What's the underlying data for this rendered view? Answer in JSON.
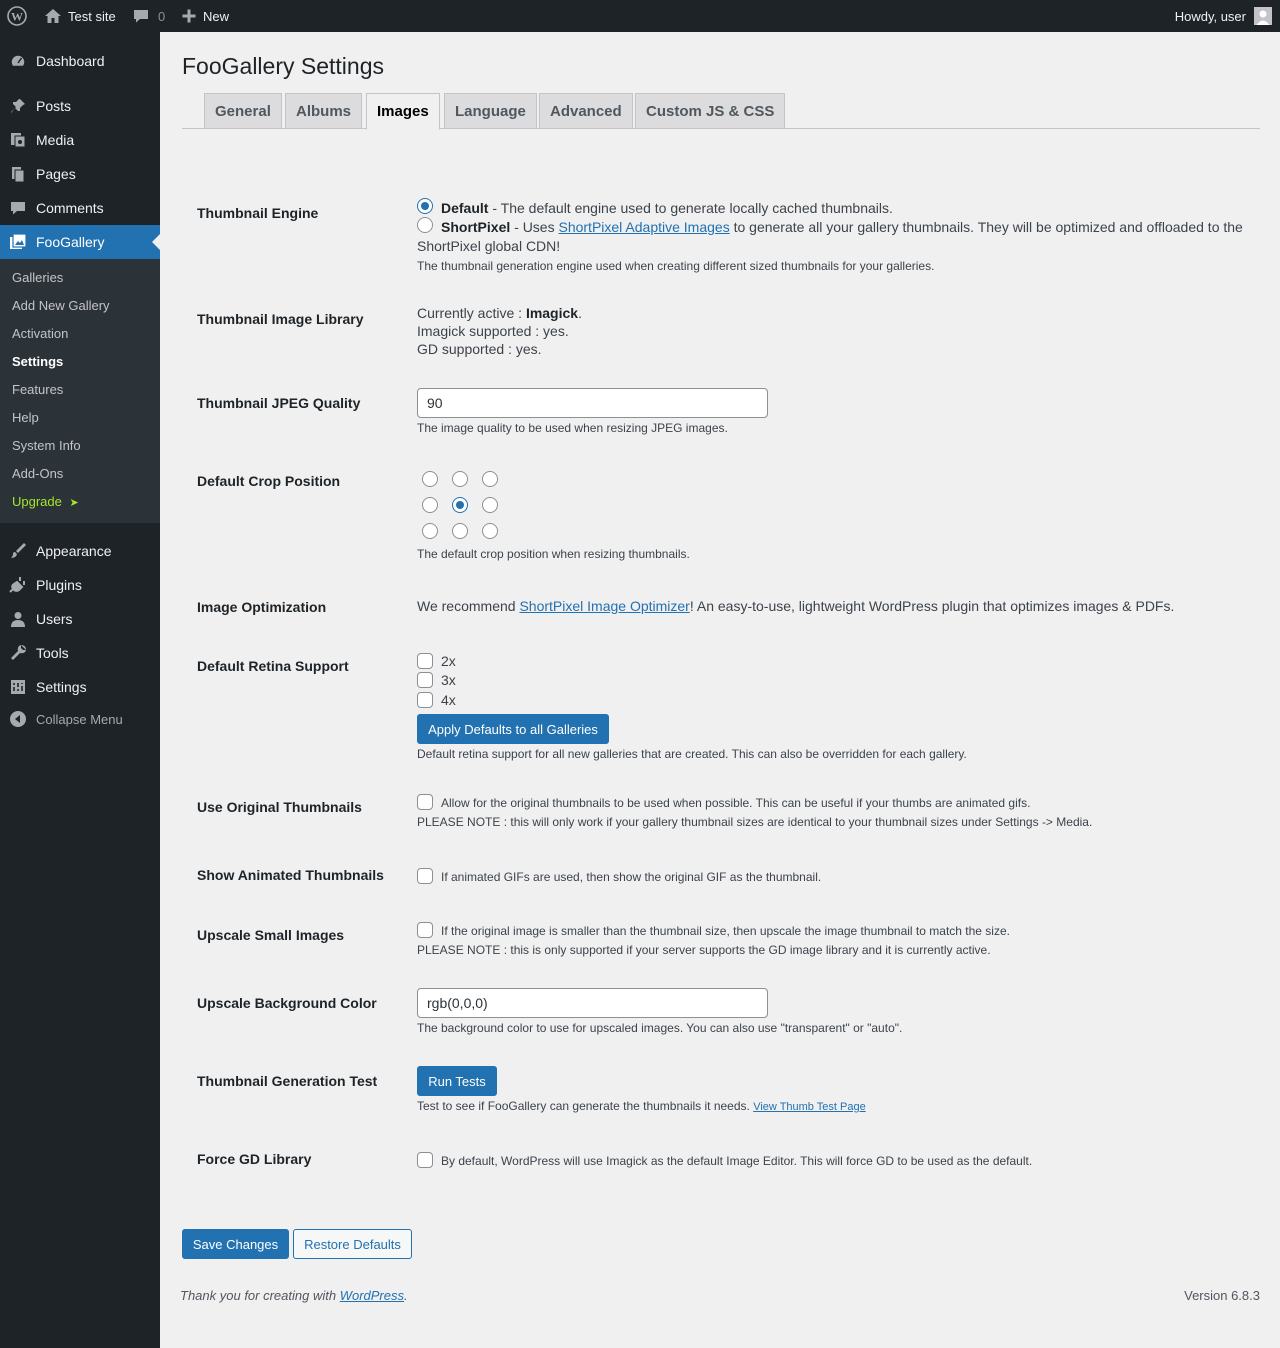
{
  "adminbar": {
    "site_name": "Test site",
    "comments_count": "0",
    "new_label": "New",
    "howdy": "Howdy, user"
  },
  "sidebar": {
    "items": [
      {
        "label": "Dashboard",
        "icon": "dashboard-icon"
      },
      {
        "label": "Posts",
        "icon": "pin-icon"
      },
      {
        "label": "Media",
        "icon": "media-icon"
      },
      {
        "label": "Pages",
        "icon": "pages-icon"
      },
      {
        "label": "Comments",
        "icon": "comment-icon"
      },
      {
        "label": "FooGallery",
        "icon": "gallery-icon",
        "active": true
      },
      {
        "label": "Appearance",
        "icon": "brush-icon"
      },
      {
        "label": "Plugins",
        "icon": "plug-icon"
      },
      {
        "label": "Users",
        "icon": "user-icon"
      },
      {
        "label": "Tools",
        "icon": "wrench-icon"
      },
      {
        "label": "Settings",
        "icon": "settings-icon"
      }
    ],
    "submenu": [
      "Galleries",
      "Add New Gallery",
      "Activation",
      "Settings",
      "Features",
      "Help",
      "System Info",
      "Add-Ons",
      "Upgrade"
    ],
    "upgrade_arrow": "➤",
    "collapse_label": "Collapse Menu"
  },
  "page": {
    "title": "FooGallery Settings",
    "tabs": [
      "General",
      "Albums",
      "Images",
      "Language",
      "Advanced",
      "Custom JS & CSS"
    ],
    "active_tab": "Images"
  },
  "settings": {
    "thumb_engine": {
      "label": "Thumbnail Engine",
      "opt1_name": "Default",
      "opt1_text": " - The default engine used to generate locally cached thumbnails.",
      "opt2_name": "ShortPixel",
      "opt2_pre": " - Uses ",
      "opt2_link": "ShortPixel Adaptive Images",
      "opt2_post": " to generate all your gallery thumbnails. They will be optimized and offloaded to the",
      "opt2_line2": "ShortPixel global CDN!",
      "desc": "The thumbnail generation engine used when creating different sized thumbnails for your galleries."
    },
    "image_library": {
      "label": "Thumbnail Image Library",
      "active_pre": "Currently active : ",
      "active_value": "Imagick",
      "active_post": ".",
      "imagick": "Imagick supported : yes.",
      "gd": "GD supported : yes."
    },
    "jpeg_quality": {
      "label": "Thumbnail JPEG Quality",
      "value": "90",
      "desc": "The image quality to be used when resizing JPEG images."
    },
    "crop_position": {
      "label": "Default Crop Position",
      "selected": "center",
      "desc": "The default crop position when resizing thumbnails."
    },
    "optimization": {
      "label": "Image Optimization",
      "pre": "We recommend ",
      "link": "ShortPixel Image Optimizer",
      "post": "! An easy-to-use, lightweight WordPress plugin that optimizes images & PDFs."
    },
    "retina": {
      "label": "Default Retina Support",
      "options": [
        "2x",
        "3x",
        "4x"
      ],
      "button": "Apply Defaults to all Galleries",
      "desc": "Default retina support for all new galleries that are created. This can also be overridden for each gallery."
    },
    "original_thumbs": {
      "label": "Use Original Thumbnails",
      "text": "Allow for the original thumbnails to be used when possible. This can be useful if your thumbs are animated gifs.",
      "note": "PLEASE NOTE : this will only work if your gallery thumbnail sizes are identical to your thumbnail sizes under Settings -> Media."
    },
    "animated": {
      "label": "Show Animated Thumbnails",
      "text": "If animated GIFs are used, then show the original GIF as the thumbnail."
    },
    "upscale": {
      "label": "Upscale Small Images",
      "text": "If the original image is smaller than the thumbnail size, then upscale the image thumbnail to match the size.",
      "note": "PLEASE NOTE : this is only supported if your server supports the GD image library and it is currently active."
    },
    "upscale_bg": {
      "label": "Upscale Background Color",
      "value": "rgb(0,0,0)",
      "desc": "The background color to use for upscaled images. You can also use \"transparent\" or \"auto\"."
    },
    "gen_test": {
      "label": "Thumbnail Generation Test",
      "button": "Run Tests",
      "desc": "Test to see if FooGallery can generate the thumbnails it needs. ",
      "link": "View Thumb Test Page"
    },
    "force_gd": {
      "label": "Force GD Library",
      "text": "By default, WordPress will use Imagick as the default Image Editor. This will force GD to be used as the default."
    }
  },
  "actions": {
    "save": "Save Changes",
    "restore": "Restore Defaults"
  },
  "footer": {
    "thanks_pre": "Thank you for creating with ",
    "thanks_link": "WordPress",
    "thanks_post": ".",
    "version": "Version 6.8.3"
  },
  "colors": {
    "accent": "#2271b1",
    "adminbar": "#1d2327",
    "submenu_bg": "#2c3338",
    "upgrade": "#a4e62a"
  }
}
